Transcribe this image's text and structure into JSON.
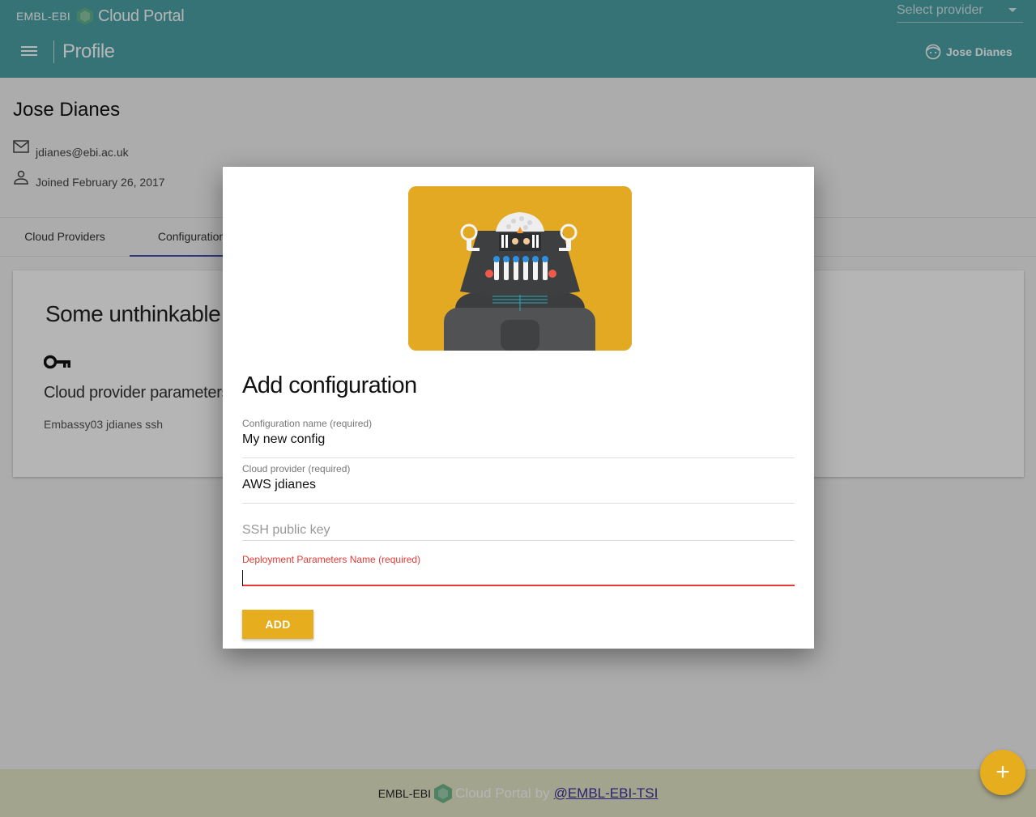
{
  "header": {
    "brand_left": "EMBL-EBI",
    "brand_right": "Cloud Portal",
    "provider_select": "Select provider",
    "page_title": "Profile",
    "user_name": "Jose Dianes"
  },
  "profile": {
    "name": "Jose Dianes",
    "email": "jdianes@ebi.ac.uk",
    "joined": "Joined February 26, 2017"
  },
  "tabs": [
    {
      "label": "Cloud Providers"
    },
    {
      "label": "Configurations"
    }
  ],
  "card": {
    "title": "Some unthinkable config",
    "subtitle": "Cloud provider parameters",
    "item": "Embassy03 jdianes ssh"
  },
  "dialog": {
    "title": "Add configuration",
    "fields": [
      {
        "label": "Configuration name (required)",
        "value": "My new config"
      },
      {
        "label": "Cloud provider (required)",
        "value": "AWS jdianes"
      },
      {
        "placeholder": "SSH public key"
      },
      {
        "label": "Deployment Parameters Name (required)",
        "value": ""
      }
    ],
    "add_label": "ADD"
  },
  "footer": {
    "left": "EMBL-EBI",
    "portal": "Cloud Portal",
    "by": "by",
    "link": "@EMBL-EBI-TSI"
  },
  "fab": {
    "label": "+"
  },
  "colors": {
    "header": "#4ba3a8",
    "accent": "#e6ae1e",
    "tab_indicator": "#3f51b5",
    "error": "#e53935",
    "footer": "#e6e7c7"
  }
}
